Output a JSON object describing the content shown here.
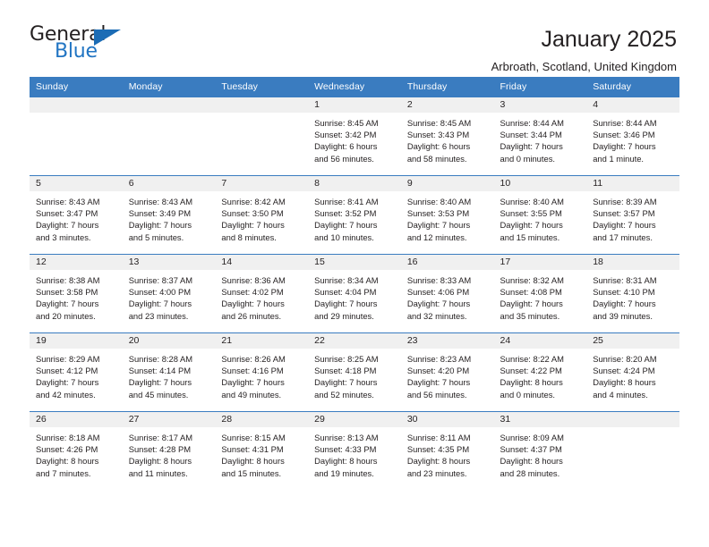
{
  "logo": {
    "part1": "General",
    "part2": "Blue",
    "triangle_color": "#1b6cb5",
    "blue_color": "#2275c3"
  },
  "header": {
    "title": "January 2025",
    "subtitle": "Arbroath, Scotland, United Kingdom"
  },
  "theme": {
    "header_blue": "#3a7cc0",
    "daynum_gray": "#f0f0f0"
  },
  "weekdays": [
    "Sunday",
    "Monday",
    "Tuesday",
    "Wednesday",
    "Thursday",
    "Friday",
    "Saturday"
  ],
  "weeks": [
    [
      {
        "day": "",
        "empty": true
      },
      {
        "day": "",
        "empty": true
      },
      {
        "day": "",
        "empty": true
      },
      {
        "day": "1",
        "sunrise": "Sunrise: 8:45 AM",
        "sunset": "Sunset: 3:42 PM",
        "daylight1": "Daylight: 6 hours",
        "daylight2": "and 56 minutes."
      },
      {
        "day": "2",
        "sunrise": "Sunrise: 8:45 AM",
        "sunset": "Sunset: 3:43 PM",
        "daylight1": "Daylight: 6 hours",
        "daylight2": "and 58 minutes."
      },
      {
        "day": "3",
        "sunrise": "Sunrise: 8:44 AM",
        "sunset": "Sunset: 3:44 PM",
        "daylight1": "Daylight: 7 hours",
        "daylight2": "and 0 minutes."
      },
      {
        "day": "4",
        "sunrise": "Sunrise: 8:44 AM",
        "sunset": "Sunset: 3:46 PM",
        "daylight1": "Daylight: 7 hours",
        "daylight2": "and 1 minute."
      }
    ],
    [
      {
        "day": "5",
        "sunrise": "Sunrise: 8:43 AM",
        "sunset": "Sunset: 3:47 PM",
        "daylight1": "Daylight: 7 hours",
        "daylight2": "and 3 minutes."
      },
      {
        "day": "6",
        "sunrise": "Sunrise: 8:43 AM",
        "sunset": "Sunset: 3:49 PM",
        "daylight1": "Daylight: 7 hours",
        "daylight2": "and 5 minutes."
      },
      {
        "day": "7",
        "sunrise": "Sunrise: 8:42 AM",
        "sunset": "Sunset: 3:50 PM",
        "daylight1": "Daylight: 7 hours",
        "daylight2": "and 8 minutes."
      },
      {
        "day": "8",
        "sunrise": "Sunrise: 8:41 AM",
        "sunset": "Sunset: 3:52 PM",
        "daylight1": "Daylight: 7 hours",
        "daylight2": "and 10 minutes."
      },
      {
        "day": "9",
        "sunrise": "Sunrise: 8:40 AM",
        "sunset": "Sunset: 3:53 PM",
        "daylight1": "Daylight: 7 hours",
        "daylight2": "and 12 minutes."
      },
      {
        "day": "10",
        "sunrise": "Sunrise: 8:40 AM",
        "sunset": "Sunset: 3:55 PM",
        "daylight1": "Daylight: 7 hours",
        "daylight2": "and 15 minutes."
      },
      {
        "day": "11",
        "sunrise": "Sunrise: 8:39 AM",
        "sunset": "Sunset: 3:57 PM",
        "daylight1": "Daylight: 7 hours",
        "daylight2": "and 17 minutes."
      }
    ],
    [
      {
        "day": "12",
        "sunrise": "Sunrise: 8:38 AM",
        "sunset": "Sunset: 3:58 PM",
        "daylight1": "Daylight: 7 hours",
        "daylight2": "and 20 minutes."
      },
      {
        "day": "13",
        "sunrise": "Sunrise: 8:37 AM",
        "sunset": "Sunset: 4:00 PM",
        "daylight1": "Daylight: 7 hours",
        "daylight2": "and 23 minutes."
      },
      {
        "day": "14",
        "sunrise": "Sunrise: 8:36 AM",
        "sunset": "Sunset: 4:02 PM",
        "daylight1": "Daylight: 7 hours",
        "daylight2": "and 26 minutes."
      },
      {
        "day": "15",
        "sunrise": "Sunrise: 8:34 AM",
        "sunset": "Sunset: 4:04 PM",
        "daylight1": "Daylight: 7 hours",
        "daylight2": "and 29 minutes."
      },
      {
        "day": "16",
        "sunrise": "Sunrise: 8:33 AM",
        "sunset": "Sunset: 4:06 PM",
        "daylight1": "Daylight: 7 hours",
        "daylight2": "and 32 minutes."
      },
      {
        "day": "17",
        "sunrise": "Sunrise: 8:32 AM",
        "sunset": "Sunset: 4:08 PM",
        "daylight1": "Daylight: 7 hours",
        "daylight2": "and 35 minutes."
      },
      {
        "day": "18",
        "sunrise": "Sunrise: 8:31 AM",
        "sunset": "Sunset: 4:10 PM",
        "daylight1": "Daylight: 7 hours",
        "daylight2": "and 39 minutes."
      }
    ],
    [
      {
        "day": "19",
        "sunrise": "Sunrise: 8:29 AM",
        "sunset": "Sunset: 4:12 PM",
        "daylight1": "Daylight: 7 hours",
        "daylight2": "and 42 minutes."
      },
      {
        "day": "20",
        "sunrise": "Sunrise: 8:28 AM",
        "sunset": "Sunset: 4:14 PM",
        "daylight1": "Daylight: 7 hours",
        "daylight2": "and 45 minutes."
      },
      {
        "day": "21",
        "sunrise": "Sunrise: 8:26 AM",
        "sunset": "Sunset: 4:16 PM",
        "daylight1": "Daylight: 7 hours",
        "daylight2": "and 49 minutes."
      },
      {
        "day": "22",
        "sunrise": "Sunrise: 8:25 AM",
        "sunset": "Sunset: 4:18 PM",
        "daylight1": "Daylight: 7 hours",
        "daylight2": "and 52 minutes."
      },
      {
        "day": "23",
        "sunrise": "Sunrise: 8:23 AM",
        "sunset": "Sunset: 4:20 PM",
        "daylight1": "Daylight: 7 hours",
        "daylight2": "and 56 minutes."
      },
      {
        "day": "24",
        "sunrise": "Sunrise: 8:22 AM",
        "sunset": "Sunset: 4:22 PM",
        "daylight1": "Daylight: 8 hours",
        "daylight2": "and 0 minutes."
      },
      {
        "day": "25",
        "sunrise": "Sunrise: 8:20 AM",
        "sunset": "Sunset: 4:24 PM",
        "daylight1": "Daylight: 8 hours",
        "daylight2": "and 4 minutes."
      }
    ],
    [
      {
        "day": "26",
        "sunrise": "Sunrise: 8:18 AM",
        "sunset": "Sunset: 4:26 PM",
        "daylight1": "Daylight: 8 hours",
        "daylight2": "and 7 minutes."
      },
      {
        "day": "27",
        "sunrise": "Sunrise: 8:17 AM",
        "sunset": "Sunset: 4:28 PM",
        "daylight1": "Daylight: 8 hours",
        "daylight2": "and 11 minutes."
      },
      {
        "day": "28",
        "sunrise": "Sunrise: 8:15 AM",
        "sunset": "Sunset: 4:31 PM",
        "daylight1": "Daylight: 8 hours",
        "daylight2": "and 15 minutes."
      },
      {
        "day": "29",
        "sunrise": "Sunrise: 8:13 AM",
        "sunset": "Sunset: 4:33 PM",
        "daylight1": "Daylight: 8 hours",
        "daylight2": "and 19 minutes."
      },
      {
        "day": "30",
        "sunrise": "Sunrise: 8:11 AM",
        "sunset": "Sunset: 4:35 PM",
        "daylight1": "Daylight: 8 hours",
        "daylight2": "and 23 minutes."
      },
      {
        "day": "31",
        "sunrise": "Sunrise: 8:09 AM",
        "sunset": "Sunset: 4:37 PM",
        "daylight1": "Daylight: 8 hours",
        "daylight2": "and 28 minutes."
      },
      {
        "day": "",
        "empty": true
      }
    ]
  ]
}
